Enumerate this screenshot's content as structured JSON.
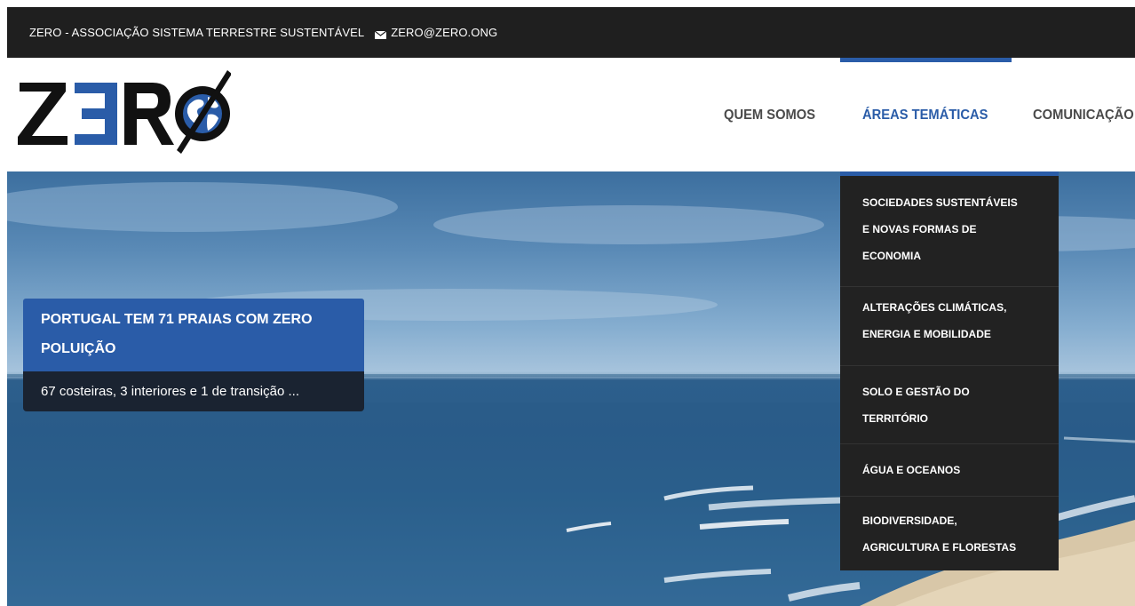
{
  "topbar": {
    "org_name": "ZERO - ASSOCIAÇÃO SISTEMA TERRESTRE SUSTENTÁVEL",
    "email_icon": "envelope-icon",
    "email": "ZERO@ZERO.ONG"
  },
  "header": {
    "logo_text": "ZERO",
    "logo_icon": "globe-icon",
    "nav": [
      {
        "label": "QUEM SOMOS"
      },
      {
        "label": "ÁREAS TEMÁTICAS"
      },
      {
        "label": "COMUNICAÇÃO"
      }
    ]
  },
  "hero": {
    "headline_line1": "PORTUGAL TEM 71 PRAIAS COM ZERO",
    "headline_line2": "POLUIÇÃO",
    "subtitle": "67 costeiras, 3 interiores e 1 de transição ..."
  },
  "dropdown": {
    "items": [
      {
        "line1": "SOCIEDADES SUSTENTÁVEIS",
        "line2": "E NOVAS FORMAS DE",
        "line3": "ECONOMIA"
      },
      {
        "line1": "ALTERAÇÕES CLIMÁTICAS,",
        "line2": "ENERGIA E MOBILIDADE"
      },
      {
        "line1": "SOLO E GESTÃO DO",
        "line2": "TERRITÓRIO"
      },
      {
        "line1": "ÁGUA E OCEANOS"
      },
      {
        "line1": "BIODIVERSIDADE,",
        "line2": "AGRICULTURA E FLORESTAS"
      }
    ]
  },
  "colors": {
    "topbar_bg": "#1f1f1f",
    "accent_blue": "#2a5ca8",
    "dropdown_bg": "#222222",
    "subtitle_bg": "#1a2331",
    "nav_text": "#4a4a4a"
  }
}
